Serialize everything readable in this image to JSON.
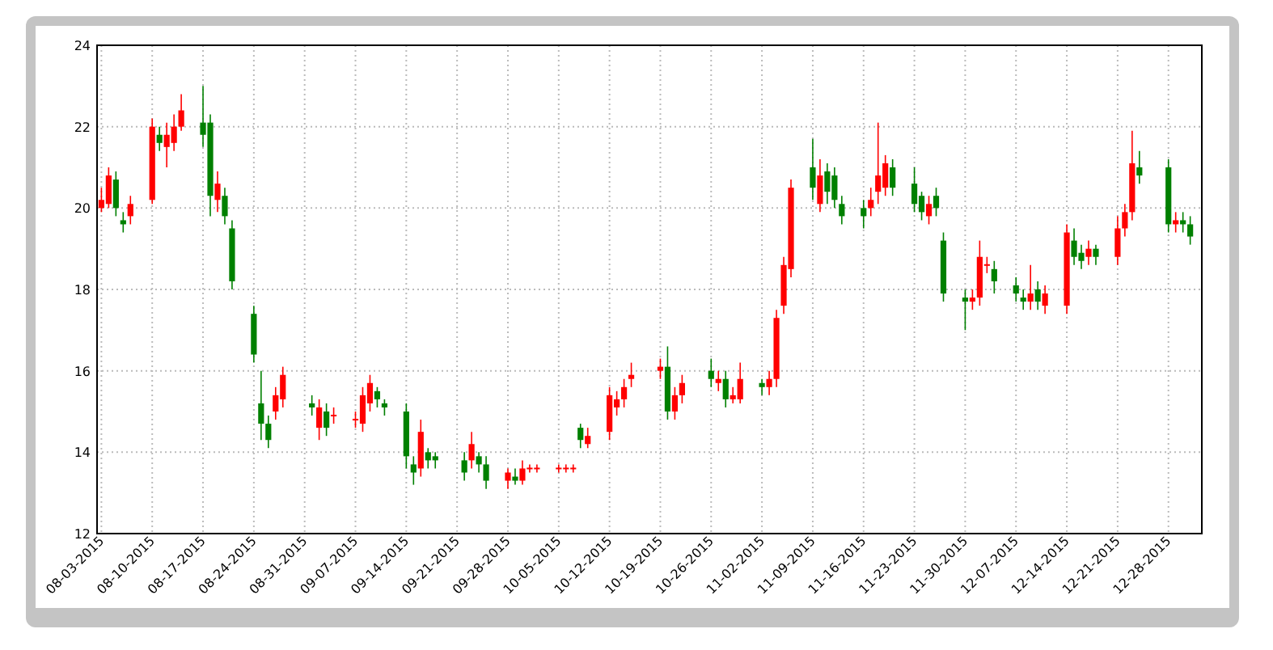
{
  "figure": {
    "chart_data": {
      "type": "candlestick",
      "grid": true,
      "ylim": [
        12,
        24
      ],
      "yticks": [
        12,
        14,
        16,
        18,
        20,
        22,
        24
      ],
      "categories": [
        "08-03-2015",
        null,
        null,
        null,
        null,
        null,
        null,
        "08-10-2015",
        null,
        null,
        null,
        null,
        null,
        null,
        "08-17-2015",
        null,
        null,
        null,
        null,
        null,
        null,
        "08-24-2015",
        null,
        null,
        null,
        null,
        null,
        null,
        "08-31-2015",
        null,
        null,
        null,
        null,
        null,
        null,
        "09-07-2015",
        null,
        null,
        null,
        null,
        null,
        null,
        "09-14-2015",
        null,
        null,
        null,
        null,
        null,
        null,
        "09-21-2015",
        null,
        null,
        null,
        null,
        null,
        null,
        "09-28-2015",
        null,
        null,
        null,
        null,
        null,
        null,
        "10-05-2015",
        null,
        null,
        null,
        null,
        null,
        null,
        "10-12-2015",
        null,
        null,
        null,
        null,
        null,
        null,
        "10-19-2015",
        null,
        null,
        null,
        null,
        null,
        null,
        "10-26-2015",
        null,
        null,
        null,
        null,
        null,
        null,
        "11-02-2015",
        null,
        null,
        null,
        null,
        null,
        null,
        "11-09-2015",
        null,
        null,
        null,
        null,
        null,
        null,
        "11-16-2015",
        null,
        null,
        null,
        null,
        null,
        null,
        "11-23-2015",
        null,
        null,
        null,
        null,
        null,
        null,
        "11-30-2015",
        null,
        null,
        null,
        null,
        null,
        null,
        "12-07-2015",
        null,
        null,
        null,
        null,
        null,
        null,
        "12-14-2015",
        null,
        null,
        null,
        null,
        null,
        null,
        "12-21-2015",
        null,
        null,
        null,
        null,
        null,
        null,
        "12-28-2015",
        null,
        null,
        null,
        null
      ],
      "ohlc": [
        [
          20,
          20.5,
          19.9,
          20.2
        ],
        [
          20.1,
          21,
          20,
          20.8
        ],
        [
          20.7,
          20.9,
          19.8,
          20
        ],
        [
          19.7,
          19.9,
          19.4,
          19.6
        ],
        [
          19.8,
          20.3,
          19.6,
          20.1
        ],
        null,
        null,
        [
          20.2,
          22.2,
          20.1,
          22
        ],
        [
          21.8,
          22,
          21.4,
          21.6
        ],
        [
          21.5,
          22.1,
          21,
          21.8
        ],
        [
          21.6,
          22.3,
          21.4,
          22
        ],
        [
          22,
          22.8,
          21.9,
          22.4
        ],
        null,
        null,
        [
          22.1,
          23,
          21.5,
          21.8
        ],
        [
          22.1,
          22.3,
          19.8,
          20.3
        ],
        [
          20.2,
          20.9,
          19.9,
          20.6
        ],
        [
          20.3,
          20.5,
          19.6,
          19.8
        ],
        [
          19.5,
          19.7,
          18,
          18.2
        ],
        null,
        null,
        [
          17.4,
          17.6,
          16.2,
          16.4
        ],
        [
          15.2,
          16,
          14.3,
          14.7
        ],
        [
          14.7,
          14.9,
          14.1,
          14.3
        ],
        [
          15,
          15.6,
          14.8,
          15.4
        ],
        [
          15.3,
          16.1,
          15.1,
          15.9
        ],
        null,
        null,
        null,
        [
          15.2,
          15.4,
          14.9,
          15.1
        ],
        [
          14.6,
          15.3,
          14.3,
          15.1
        ],
        [
          15,
          15.2,
          14.4,
          14.6
        ],
        [
          14.9,
          15.1,
          14.7,
          14.9
        ],
        null,
        null,
        [
          14.8,
          15,
          14.6,
          14.8
        ],
        [
          14.7,
          15.6,
          14.5,
          15.4
        ],
        [
          15.2,
          15.9,
          15,
          15.7
        ],
        [
          15.5,
          15.6,
          15.1,
          15.3
        ],
        [
          15.2,
          15.3,
          14.9,
          15.1
        ],
        null,
        null,
        [
          15,
          15.2,
          13.6,
          13.9
        ],
        [
          13.7,
          13.9,
          13.2,
          13.5
        ],
        [
          13.6,
          14.8,
          13.4,
          14.5
        ],
        [
          14,
          14.1,
          13.6,
          13.8
        ],
        [
          13.9,
          14,
          13.6,
          13.8
        ],
        null,
        null,
        null,
        [
          13.8,
          14,
          13.3,
          13.5
        ],
        [
          13.8,
          14.5,
          13.6,
          14.2
        ],
        [
          13.9,
          14,
          13.5,
          13.7
        ],
        [
          13.7,
          13.9,
          13.1,
          13.3
        ],
        null,
        null,
        [
          13.3,
          13.6,
          13.1,
          13.5
        ],
        [
          13.4,
          13.6,
          13.2,
          13.3
        ],
        [
          13.3,
          13.8,
          13.2,
          13.6
        ],
        [
          13.6,
          13.7,
          13.5,
          13.6
        ],
        [
          13.6,
          13.7,
          13.5,
          13.6
        ],
        null,
        null,
        [
          13.6,
          13.7,
          13.5,
          13.6
        ],
        [
          13.6,
          13.7,
          13.5,
          13.6
        ],
        [
          13.6,
          13.7,
          13.5,
          13.6
        ],
        [
          14.6,
          14.7,
          14.1,
          14.3
        ],
        [
          14.2,
          14.6,
          14.1,
          14.4
        ],
        null,
        null,
        [
          14.5,
          15.6,
          14.3,
          15.4
        ],
        [
          15.1,
          15.5,
          14.9,
          15.3
        ],
        [
          15.3,
          15.8,
          15.1,
          15.6
        ],
        [
          15.8,
          16.2,
          15.6,
          15.9
        ],
        null,
        null,
        null,
        [
          16,
          16.3,
          15.8,
          16.1
        ],
        [
          16.1,
          16.6,
          14.8,
          15
        ],
        [
          15,
          15.6,
          14.8,
          15.4
        ],
        [
          15.4,
          15.9,
          15.2,
          15.7
        ],
        null,
        null,
        null,
        [
          16,
          16.3,
          15.6,
          15.8
        ],
        [
          15.7,
          16,
          15.5,
          15.8
        ],
        [
          15.8,
          16,
          15.1,
          15.3
        ],
        [
          15.3,
          15.6,
          15.2,
          15.4
        ],
        [
          15.3,
          16.2,
          15.2,
          15.8
        ],
        null,
        null,
        [
          15.7,
          15.8,
          15.4,
          15.6
        ],
        [
          15.6,
          16,
          15.4,
          15.8
        ],
        [
          15.8,
          17.5,
          15.6,
          17.3
        ],
        [
          17.6,
          18.8,
          17.4,
          18.6
        ],
        [
          18.5,
          20.7,
          18.3,
          20.5
        ],
        null,
        null,
        [
          21,
          21.7,
          20.2,
          20.5
        ],
        [
          20.1,
          21.2,
          19.9,
          20.8
        ],
        [
          20.9,
          21.1,
          20.1,
          20.4
        ],
        [
          20.8,
          21,
          20,
          20.2
        ],
        [
          20.1,
          20.3,
          19.6,
          19.8
        ],
        null,
        null,
        [
          20,
          20.2,
          19.5,
          19.8
        ],
        [
          20,
          20.5,
          19.8,
          20.2
        ],
        [
          20.4,
          22.1,
          20.1,
          20.8
        ],
        [
          20.5,
          21.3,
          20.3,
          21.1
        ],
        [
          21,
          21.2,
          20.3,
          20.5
        ],
        null,
        null,
        [
          20.6,
          21,
          19.9,
          20.1
        ],
        [
          20.3,
          20.4,
          19.7,
          19.9
        ],
        [
          19.8,
          20.3,
          19.6,
          20.1
        ],
        [
          20.3,
          20.5,
          19.8,
          20
        ],
        [
          19.2,
          19.4,
          17.7,
          17.9
        ],
        null,
        null,
        [
          17.8,
          18,
          17,
          17.7
        ],
        [
          17.7,
          18,
          17.5,
          17.8
        ],
        [
          17.8,
          19.2,
          17.6,
          18.8
        ],
        [
          18.6,
          18.8,
          18.4,
          18.6
        ],
        [
          18.5,
          18.7,
          17.9,
          18.2
        ],
        null,
        null,
        [
          18.1,
          18.3,
          17.7,
          17.9
        ],
        [
          17.8,
          18,
          17.5,
          17.7
        ],
        [
          17.7,
          18.6,
          17.5,
          17.9
        ],
        [
          18,
          18.2,
          17.5,
          17.7
        ],
        [
          17.6,
          18.1,
          17.4,
          17.9
        ],
        null,
        null,
        [
          17.6,
          19.6,
          17.4,
          19.4
        ],
        [
          19.2,
          19.5,
          18.6,
          18.8
        ],
        [
          18.9,
          19.1,
          18.5,
          18.7
        ],
        [
          18.8,
          19.2,
          18.6,
          19
        ],
        [
          19,
          19.1,
          18.6,
          18.8
        ],
        null,
        null,
        [
          18.8,
          19.8,
          18.6,
          19.5
        ],
        [
          19.5,
          20.1,
          19.3,
          19.9
        ],
        [
          19.9,
          21.9,
          19.7,
          21.1
        ],
        [
          21,
          21.4,
          20.6,
          20.8
        ],
        null,
        null,
        null,
        [
          21,
          21.2,
          19.4,
          19.6
        ],
        [
          19.6,
          19.9,
          19.4,
          19.7
        ],
        [
          19.7,
          19.9,
          19.4,
          19.6
        ],
        [
          19.6,
          19.8,
          19.1,
          19.3
        ],
        null
      ]
    }
  }
}
